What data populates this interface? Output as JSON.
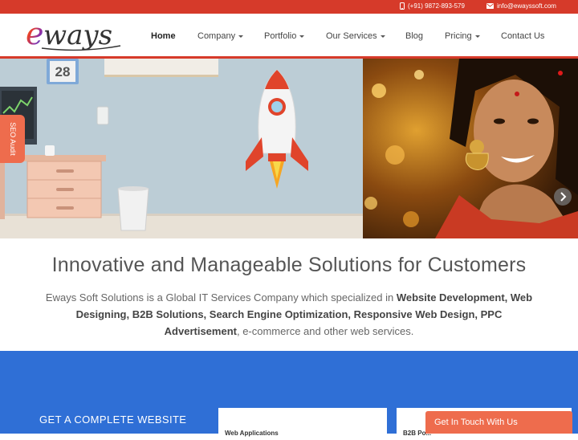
{
  "topbar": {
    "phone": "(+91) 9872-893-579",
    "email": "info@ewayssoft.com",
    "phone_icon": "phone-icon",
    "email_icon": "envelope-icon",
    "background_color": "#d63a2a"
  },
  "brand": {
    "logo_text": "eways"
  },
  "nav": {
    "items": [
      {
        "label": "Home",
        "active": true
      },
      {
        "label": "Company",
        "has_dropdown": true
      },
      {
        "label": "Portfolio",
        "has_dropdown": true
      },
      {
        "label": "Our Services",
        "has_dropdown": true
      },
      {
        "label": "Blog"
      },
      {
        "label": "Pricing",
        "has_dropdown": true
      },
      {
        "label": "Contact Us"
      }
    ]
  },
  "hero": {
    "calendar_number": "28",
    "seo_tab_label": "SEO Audit",
    "next_icon": "chevron-right-icon"
  },
  "intro": {
    "headline": "Innovative and Manageable Solutions for Customers",
    "text_1": "Eways Soft Solutions is a Global IT Services Company which specialized in ",
    "bold_1": "Website Development, Web Designing, B2B Solutions, Search Engine Optimization, Responsive Web Design, PPC Advertisement",
    "text_2": ", e-commerce and other web services."
  },
  "band": {
    "title": "GET A COMPLETE WEBSITE",
    "card_1_label": "Web Applications",
    "card_2_label": "B2B Po...",
    "accent_color": "#2f6fd6"
  },
  "cta": {
    "label": "Get In Touch With Us",
    "color": "#ee6c4d"
  }
}
